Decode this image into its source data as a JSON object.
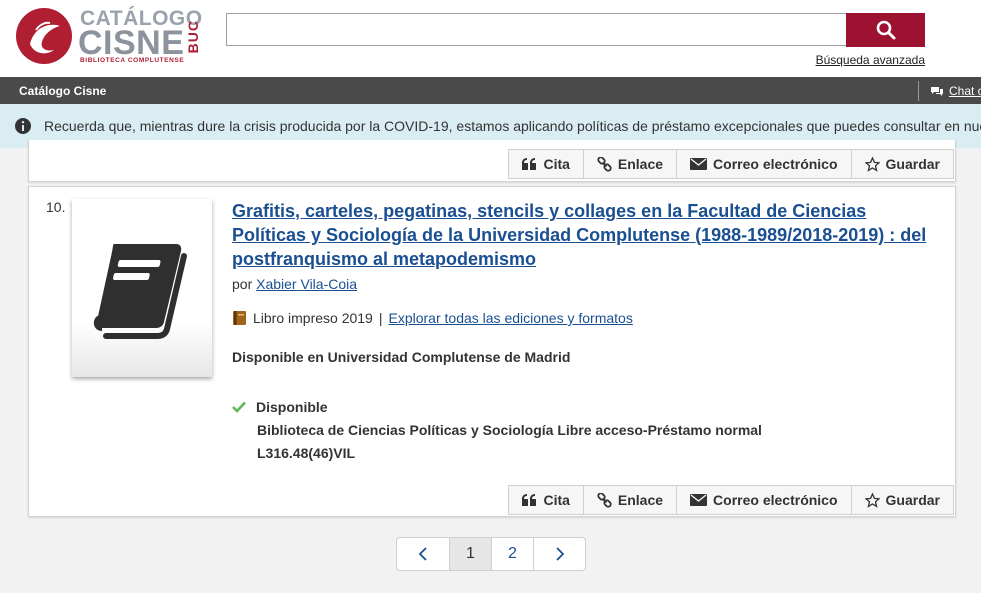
{
  "logo": {
    "top_text": "CATÁLOGO",
    "main_text": "CISNE",
    "side_text": "BUC",
    "sub_text": "BIBLIOTECA COMPLUTENSE"
  },
  "search": {
    "value": "",
    "placeholder": "",
    "advanced_link": "Búsqueda avanzada"
  },
  "nav": {
    "title": "Catálogo Cisne",
    "chat_label": "Chat con"
  },
  "alert": {
    "text": "Recuerda que, mientras dure la crisis producida por la COVID-19, estamos aplicando políticas de préstamo excepcionales que puedes consultar en nuestra web"
  },
  "toolbar_labels": {
    "cite": "Cita",
    "link": "Enlace",
    "email": "Correo electrónico",
    "save": "Guardar"
  },
  "result": {
    "number": "10.",
    "title": "Grafitis, carteles, pegatinas, stencils y collages en la Facultad de Ciencias Políticas y Sociología de la Universidad Complutense (1988-1989/2018-2019) : del postfranquismo al metapodemismo",
    "author_prefix": "por",
    "author": "Xabier Vila-Coia",
    "format": "Libro impreso 2019",
    "separator": "|",
    "editions_link": "Explorar todas las ediciones y formatos",
    "availability_summary": "Disponible en Universidad Complutense de Madrid",
    "holding_status": "Disponible",
    "holding_location": "Biblioteca de Ciencias Políticas y Sociología Libre acceso-Préstamo normal",
    "call_number": "L316.48(46)VIL"
  },
  "pagination": {
    "pages": [
      "1",
      "2"
    ],
    "current": "1"
  },
  "colors": {
    "brand": "#9c1230",
    "link": "#1a4f91",
    "navbar": "#4a4a4a",
    "alert_bg": "#d9edf3",
    "available_check": "#5cb85c"
  }
}
